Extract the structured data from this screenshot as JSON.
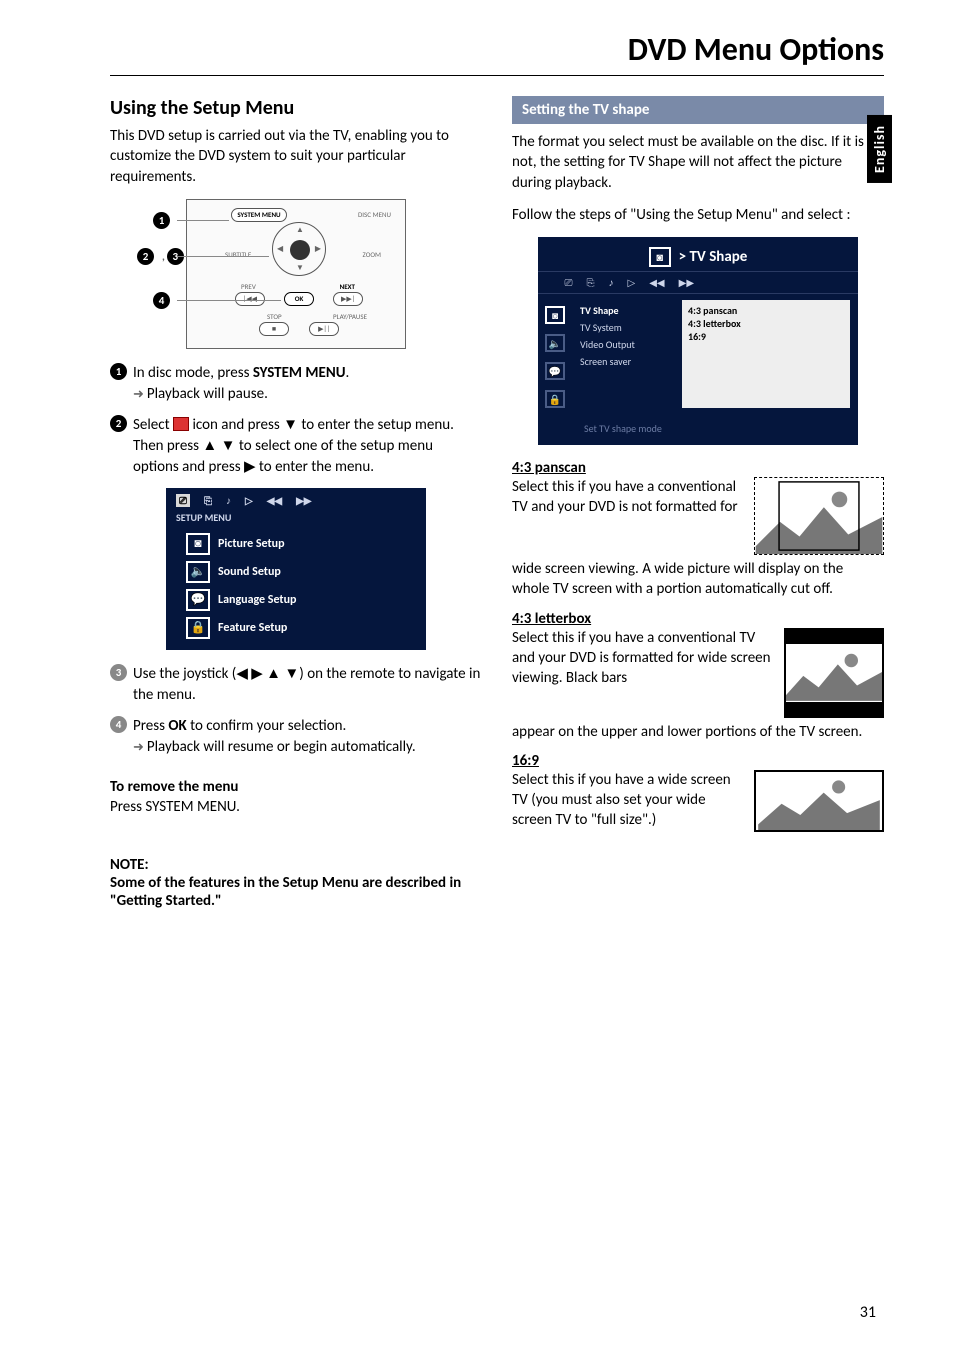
{
  "pageTitle": "DVD Menu Options",
  "sideTab": "English",
  "pageNumber": "31",
  "left": {
    "heading": "Using the Setup Menu",
    "intro": "This DVD setup is carried out via the TV, enabling you to customize the DVD system to suit your particular requirements.",
    "remote": {
      "systemMenu": "SYSTEM MENU",
      "discMenu": "DISC MENU",
      "subtitle": "SUBTITLE",
      "zoom": "ZOOM",
      "prev": "PREV",
      "next": "NEXT",
      "ok": "OK",
      "stop": "STOP",
      "playPause": "PLAY/PAUSE",
      "badges": {
        "b1": "1",
        "b23": "2, 3",
        "b4": "4"
      }
    },
    "steps": {
      "s1a": "In disc mode, press ",
      "s1b": "SYSTEM MENU",
      "s1c": ".",
      "s1resume": "Playback will pause.",
      "s2a": "Select ",
      "s2b": " icon and press ▼ to enter the setup menu.  Then press ▲ ▼ to select one of the setup menu options and press ▶ to enter the menu.",
      "s3": "Use the joystick (◀ ▶ ▲ ▼) on the remote to navigate in the menu.",
      "s4a": "Press ",
      "s4b": "OK",
      "s4c": " to confirm your selection.",
      "s4resume": "Playback will resume or begin automatically."
    },
    "setupMenu": {
      "label": "SETUP MENU",
      "items": [
        "Picture Setup",
        "Sound Setup",
        "Language Setup",
        "Feature Setup"
      ]
    },
    "removeHeading": "To remove the menu",
    "removeBody": "Press SYSTEM MENU.",
    "noteHeading": "NOTE:",
    "noteBody": "Some of the features in the Setup Menu are described in \"Getting Started.\""
  },
  "right": {
    "sectionBar": "Setting the TV shape",
    "intro1": "The format you select must be available on the disc.  If it is not, the setting for TV Shape will not affect the picture during playback.",
    "intro2a": "Follow the steps of \"",
    "intro2b": "Using the Setup Menu",
    "intro2c": "\" and select :",
    "screen": {
      "breadcrumb": ">  TV Shape",
      "midOptions": [
        "TV Shape",
        "TV System",
        "Video Output",
        "Screen saver"
      ],
      "rightOptions": [
        "4:3 panscan",
        "4:3 letterbox",
        "16:9"
      ],
      "footer": "Set TV shape mode"
    },
    "panscan": {
      "h": "4:3 panscan",
      "p1": "Select this if you have a conventional TV and your DVD is not formatted for",
      "p2": "wide screen viewing.  A wide picture will display on the whole TV screen with a portion automatically cut off."
    },
    "letterbox": {
      "h": "4:3 letterbox",
      "p1": "Select this if you have a conventional TV and your DVD is formatted for wide screen viewing.  Black bars",
      "p2": "appear on the upper and lower portions of the TV screen."
    },
    "wide": {
      "h": "16:9",
      "p": "Select this if you have a wide screen TV (you must also set your wide screen TV to \"full size\".)"
    }
  }
}
